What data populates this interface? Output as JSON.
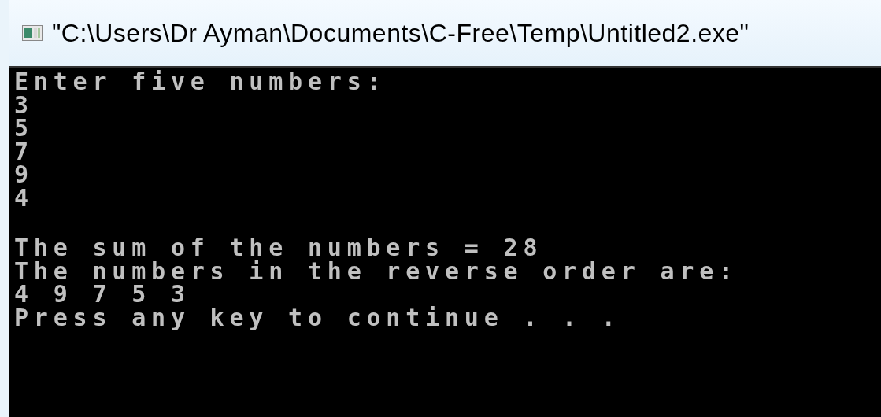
{
  "window": {
    "title": "\"C:\\Users\\Dr Ayman\\Documents\\C-Free\\Temp\\Untitled2.exe\""
  },
  "console": {
    "input_lines": [
      "Enter five numbers:",
      "3",
      "5",
      "7",
      "9",
      "4"
    ],
    "result_lines": [
      "The sum of the numbers = 28",
      "The numbers in the reverse order are:",
      "4 9 7 5 3",
      "Press any key to continue . . ."
    ]
  }
}
